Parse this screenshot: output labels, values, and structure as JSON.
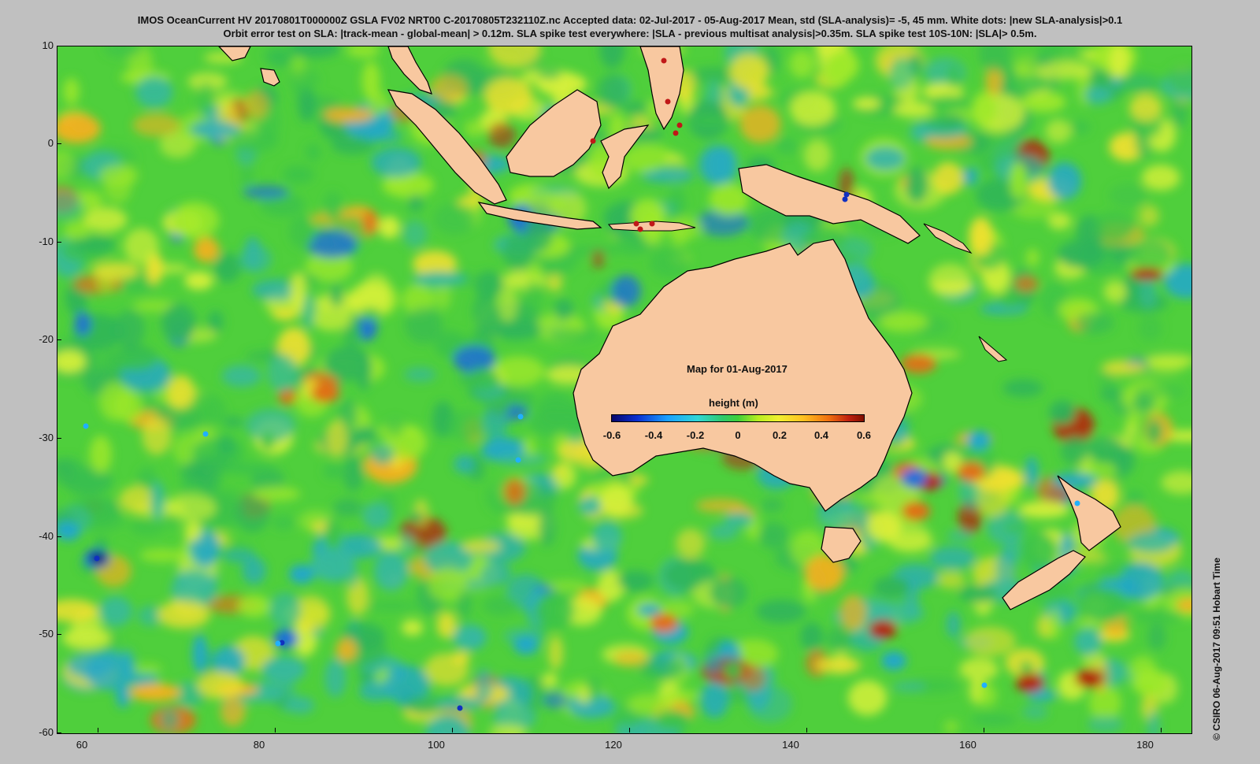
{
  "title_line_1": "IMOS OceanCurrent HV 20170801T000000Z GSLA FV02 NRT00 C-20170805T232110Z.nc  Accepted data: 02-Jul-2017 - 05-Aug-2017 Mean, std (SLA-analysis)= -5, 45 mm. White dots: |new SLA-analysis|>0.1",
  "title_line_2": "Orbit error test on SLA: |track-mean  - global-mean| > 0.12m.  SLA spike test everywhere: |SLA - previous multisat analysis|>0.35m. SLA spike test 10S-10N: |SLA|> 0.5m.",
  "map_label": "Map for 01-Aug-2017",
  "colorbar": {
    "title": "height (m)",
    "ticks": [
      "-0.6",
      "-0.4",
      "-0.2",
      "0",
      "0.2",
      "0.4",
      "0.6"
    ],
    "range": [
      -0.6,
      0.6
    ]
  },
  "axes": {
    "longitude_ticks": [
      "60",
      "80",
      "100",
      "120",
      "140",
      "160",
      "180"
    ],
    "latitude_ticks": [
      "10",
      "0",
      "-10",
      "-20",
      "-30",
      "-40",
      "-50",
      "-60"
    ],
    "lon_range": [
      57,
      185
    ],
    "lat_range": [
      -60,
      10
    ]
  },
  "credit": "© CSIRO 06-Aug-2017 09:51 Hobart Time",
  "colors": {
    "land": "#f8c8a0",
    "background": "#c0c0c0",
    "ocean_base": "#4fcf3c",
    "flagged_red": "#c01818",
    "flagged_blue": "#1030c0",
    "flagged_cyan": "#20b0ff"
  }
}
